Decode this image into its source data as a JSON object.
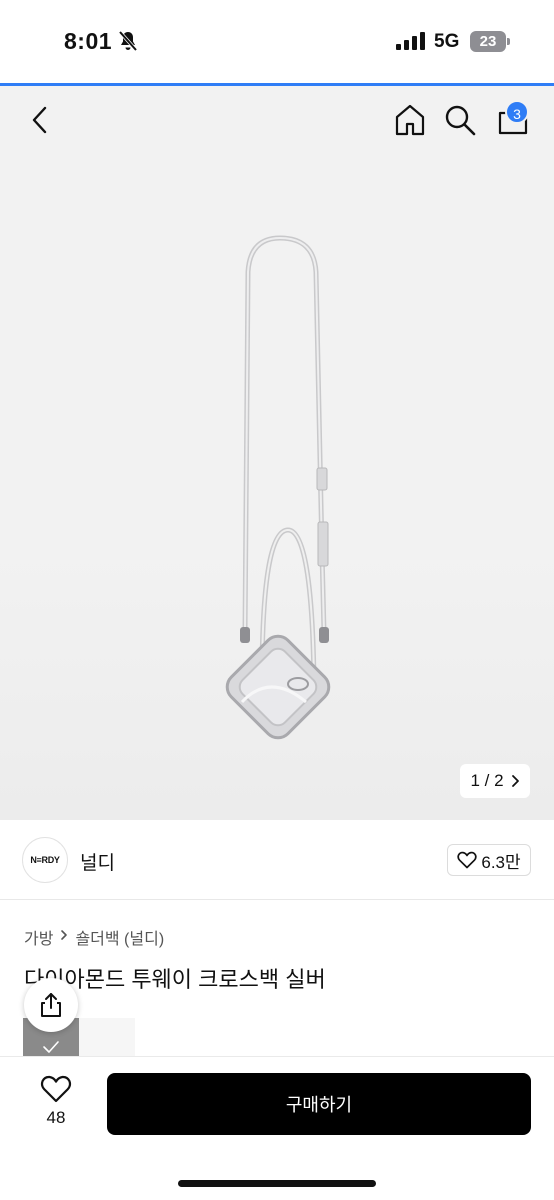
{
  "status_bar": {
    "time": "8:01",
    "network": "5G",
    "battery": "23",
    "icons": [
      "bell-slash-icon",
      "signal-icon"
    ]
  },
  "nav": {
    "icons": [
      "chevron-left-icon",
      "home-icon",
      "search-icon",
      "cart-icon"
    ],
    "cart_count": "3"
  },
  "image_pager": {
    "text": "1 / 2",
    "icon": "chevron-right-icon"
  },
  "shop": {
    "logo_text": "N≡RDY",
    "name": "널디",
    "like_count": "6.3만"
  },
  "breadcrumb": {
    "category": "가방",
    "subcategory": "숄더백 (널디)"
  },
  "product": {
    "title": "다이아몬드 투웨이 크로스백 실버"
  },
  "bottom_bar": {
    "wish_count": "48",
    "buy_label": "구매하기"
  },
  "colors": {
    "accent": "#2f7df6",
    "buy_button": "#000000"
  }
}
